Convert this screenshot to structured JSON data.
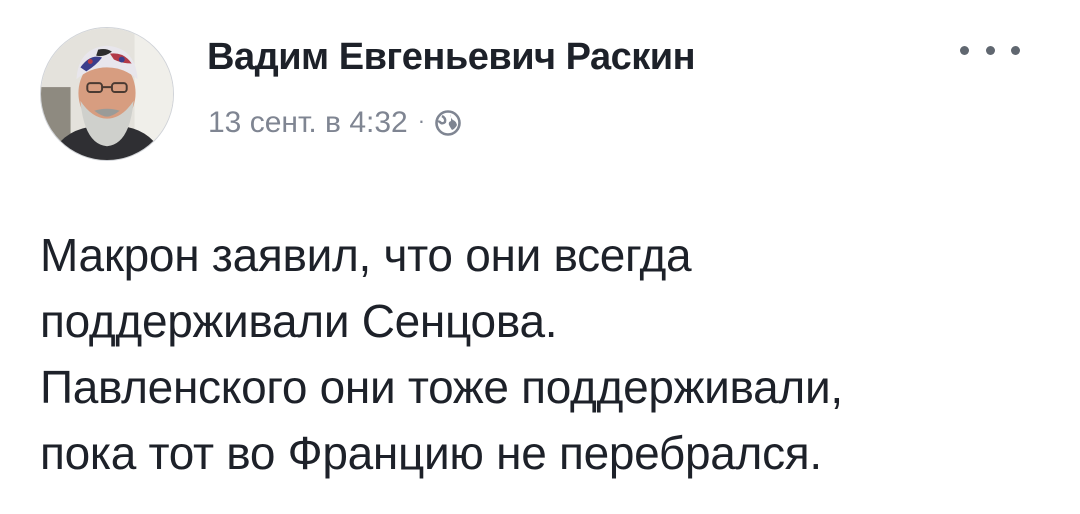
{
  "post": {
    "author": {
      "name": "Вадим Евгеньевич Раскин",
      "avatar_icon": "user-avatar-photo"
    },
    "meta": {
      "timestamp": "13 сент. в 4:32",
      "separator": "·",
      "privacy_icon": "globe-icon"
    },
    "more_icon": "ellipsis-icon",
    "text_lines": [
      "Макрон заявил, что они всегда",
      "поддерживали Сенцова.",
      "Павленского они тоже поддерживали,",
      "пока тот во Францию не перебрался."
    ]
  },
  "colors": {
    "text": "#1d2129",
    "meta": "#7f8592",
    "icon": "#606770"
  }
}
